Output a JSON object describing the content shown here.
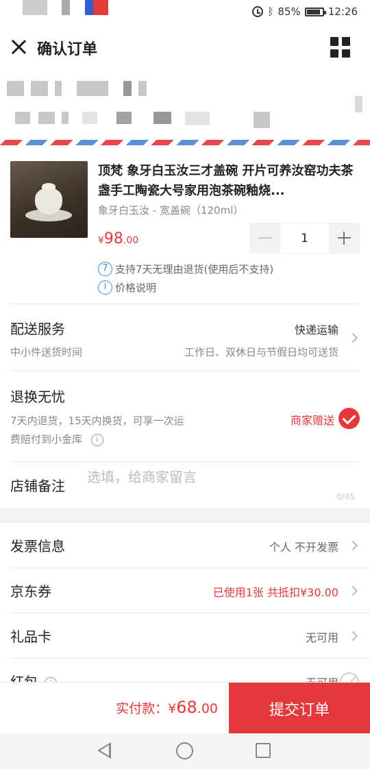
{
  "status_bar": {
    "battery": "85%",
    "time": "12:26"
  },
  "header": {
    "title": "确认订单"
  },
  "product": {
    "title": "顶梵 象牙白玉汝三才盖碗 开片可养汝窑功夫茶盏手工陶瓷大号家用泡茶碗釉烧...",
    "spec": "象牙白玉汝 - 宽盖碗（120ml）",
    "price_currency": "¥",
    "price_int": "98",
    "price_dec": ".00",
    "quantity": "1",
    "return_badge": "7",
    "return_policy": "支持7天无理由退货(使用后不支持)",
    "price_note_icon": "i",
    "price_note": "价格说明"
  },
  "delivery": {
    "title": "配送服务",
    "method": "快递运输",
    "subtitle": "中小件送货时间",
    "schedule": "工作日、双休日与节假日均可送货"
  },
  "returns": {
    "title": "退换无忧",
    "desc_line1": "7天内退货，15天内换货，可享一次运",
    "desc_line2": "费赔付到小金库",
    "gift_label": "商家赠送"
  },
  "note": {
    "label": "店铺备注",
    "placeholder": "选填，给商家留言",
    "counter": "0/45"
  },
  "invoice_list": [
    {
      "label": "发票信息",
      "value": "个人 不开发票"
    },
    {
      "label": "京东券",
      "value": "已使用1张 共抵扣¥30.00"
    },
    {
      "label": "礼品卡",
      "value": "无可用"
    },
    {
      "label": "红包",
      "value": "无可用"
    }
  ],
  "footer": {
    "total_label": "实付款：",
    "total_currency": "¥",
    "total_int": "68",
    "total_dec": ".00",
    "submit_label": "提交订单"
  },
  "colors": {
    "accent": "#e4393c",
    "info": "#3c8bd9"
  }
}
